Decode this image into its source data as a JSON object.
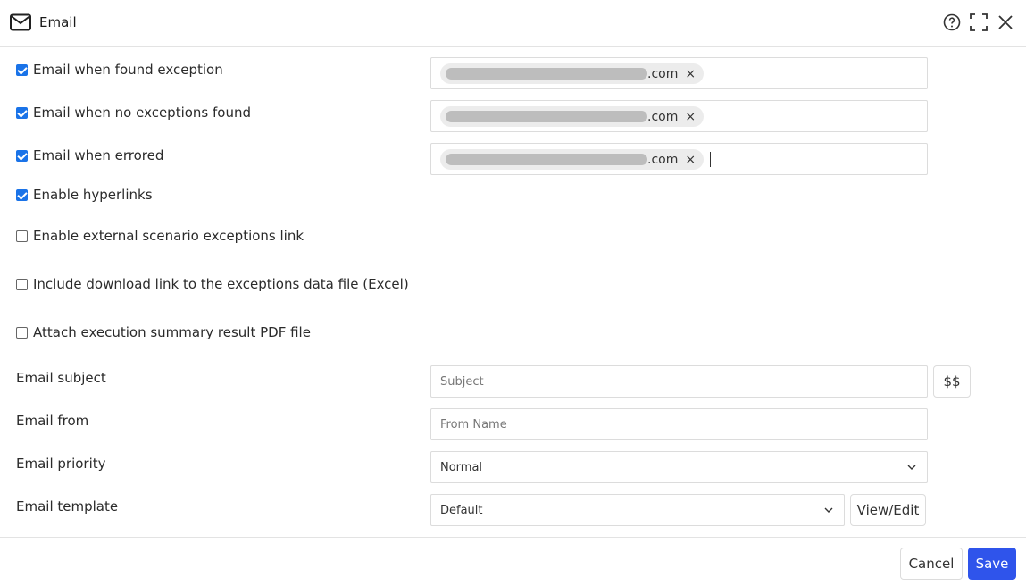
{
  "dialog": {
    "title": "Email",
    "icons": [
      "mail-icon",
      "help-icon",
      "expand-icon",
      "close-icon"
    ]
  },
  "options": [
    {
      "label": "Email when found exception",
      "checked": true
    },
    {
      "label": "Email when no exceptions found",
      "checked": true
    },
    {
      "label": "Email when errored",
      "checked": true
    },
    {
      "label": "Enable hyperlinks",
      "checked": true
    },
    {
      "label": "Enable external scenario exceptions link",
      "checked": false
    },
    {
      "label": "Include download link to the exceptions data file (Excel)",
      "checked": false
    },
    {
      "label": "Attach execution summary result PDF file",
      "checked": false
    }
  ],
  "recipients": [
    {
      "domain": ".com",
      "remove": "×"
    },
    {
      "domain": ".com",
      "remove": "×"
    },
    {
      "domain": ".com",
      "remove": "×"
    }
  ],
  "subject": {
    "label": "Email subject",
    "placeholder": "Subject",
    "variables_button": "$$"
  },
  "from": {
    "label": "Email from",
    "placeholder": "From Name"
  },
  "priority": {
    "label": "Email priority",
    "value": "Normal"
  },
  "template": {
    "label": "Email template",
    "value": "Default",
    "view_edit_button": "View/Edit"
  },
  "footer": {
    "cancel": "Cancel",
    "save": "Save"
  },
  "colors": {
    "primary": "#2f54eb",
    "checkbox": "#1a73e8"
  }
}
